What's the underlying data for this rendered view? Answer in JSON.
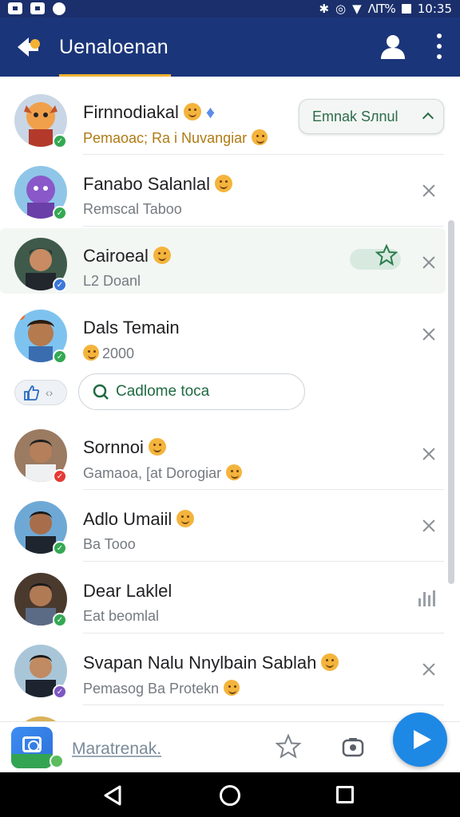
{
  "status_bar": {
    "signal_text": "ΛIT%",
    "time": "10:35"
  },
  "app_bar": {
    "title": "Uenaloenan"
  },
  "contacts": [
    {
      "name": "Firnnodiakal",
      "subtitle": "Pemaoac; Ra i Nuvangiar",
      "badge_color": "#34a853"
    },
    {
      "name": "Fanabo Salanlal",
      "subtitle": "Remscal Taboo",
      "badge_color": "#34a853"
    },
    {
      "name": "Cairoeal",
      "subtitle": "L2 Doanl",
      "badge_color": "#3b78d8"
    },
    {
      "name": "Dals Temain",
      "subtitle": "2000",
      "badge_color": "#34a853"
    },
    {
      "name": "Sornnoi",
      "subtitle": "Gamaoa, [at  Dorogiar",
      "badge_color": "#e53935"
    },
    {
      "name": "Adlo Umaiil",
      "subtitle": "Ba Tooo",
      "badge_color": "#34a853"
    },
    {
      "name": "Dear Laklel",
      "subtitle": "Eat beomlal",
      "badge_color": "#34a853"
    },
    {
      "name": "Svapan Nalu Nnylbain Sablah",
      "subtitle": "Pemasog Ba  Protekn",
      "badge_color": "#7e57c2"
    }
  ],
  "top_pill": {
    "label": "Emnak Sлnul"
  },
  "chip_row": {
    "link_label": "Cadlome toca"
  },
  "bottom_bar": {
    "input_text": "Maratrenak."
  },
  "icons": {
    "logo": "app-logo-icon",
    "user": "user-icon",
    "more": "kebab-menu-icon",
    "close": "close-icon",
    "star": "star-icon",
    "send": "send-icon",
    "camera": "camera-icon"
  },
  "colors": {
    "app_bar": "#1b357a",
    "accent": "#f2b233",
    "send": "#1e88e5",
    "link_green": "#1f6a41"
  }
}
